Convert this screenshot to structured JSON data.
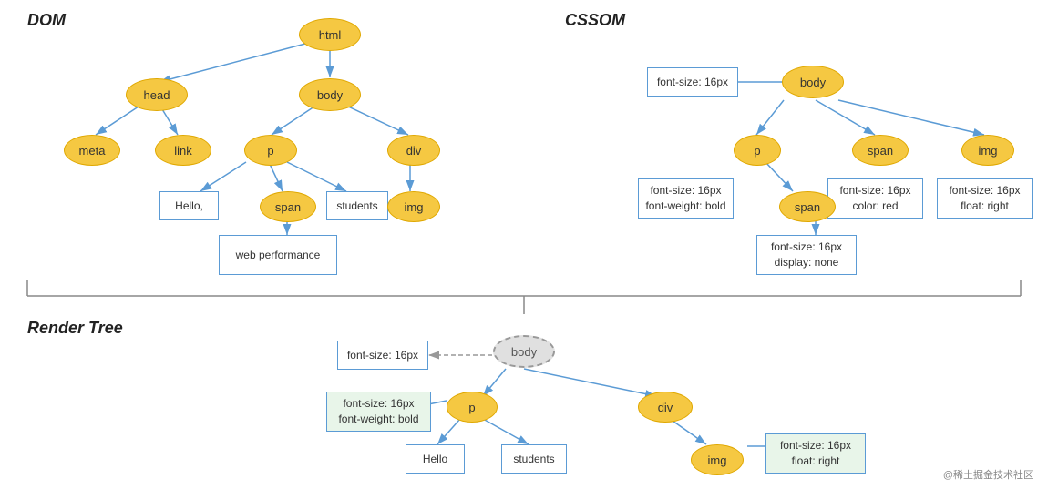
{
  "sections": {
    "dom_label": "DOM",
    "cssom_label": "CSSOM",
    "render_label": "Render Tree"
  },
  "dom_nodes": {
    "html": "html",
    "body": "body",
    "head": "head",
    "meta": "meta",
    "link": "link",
    "p": "p",
    "span": "span",
    "div": "div",
    "img": "img",
    "hello": "Hello,",
    "students": "students",
    "web_performance": "web performance"
  },
  "cssom_nodes": {
    "body": "body",
    "font_size_16": "font-size: 16px",
    "p": "p",
    "p_props": "font-size: 16px\nfont-weight: bold",
    "span_oval": "span",
    "span_props": "font-size: 16px\ndisplay: none",
    "span_label": "span",
    "span_label_props": "font-size: 16px\ncolor: red",
    "img": "img",
    "img_props": "font-size: 16px\nfloat: right"
  },
  "render_nodes": {
    "body": "body",
    "font_size_16": "font-size: 16px",
    "p": "p",
    "p_props": "font-size: 16px\nfont-weight: bold",
    "div": "div",
    "hello": "Hello",
    "students": "students",
    "img": "img",
    "img_props": "font-size: 16px\nfloat: right"
  },
  "watermark": "@稀土掘金技术社区"
}
